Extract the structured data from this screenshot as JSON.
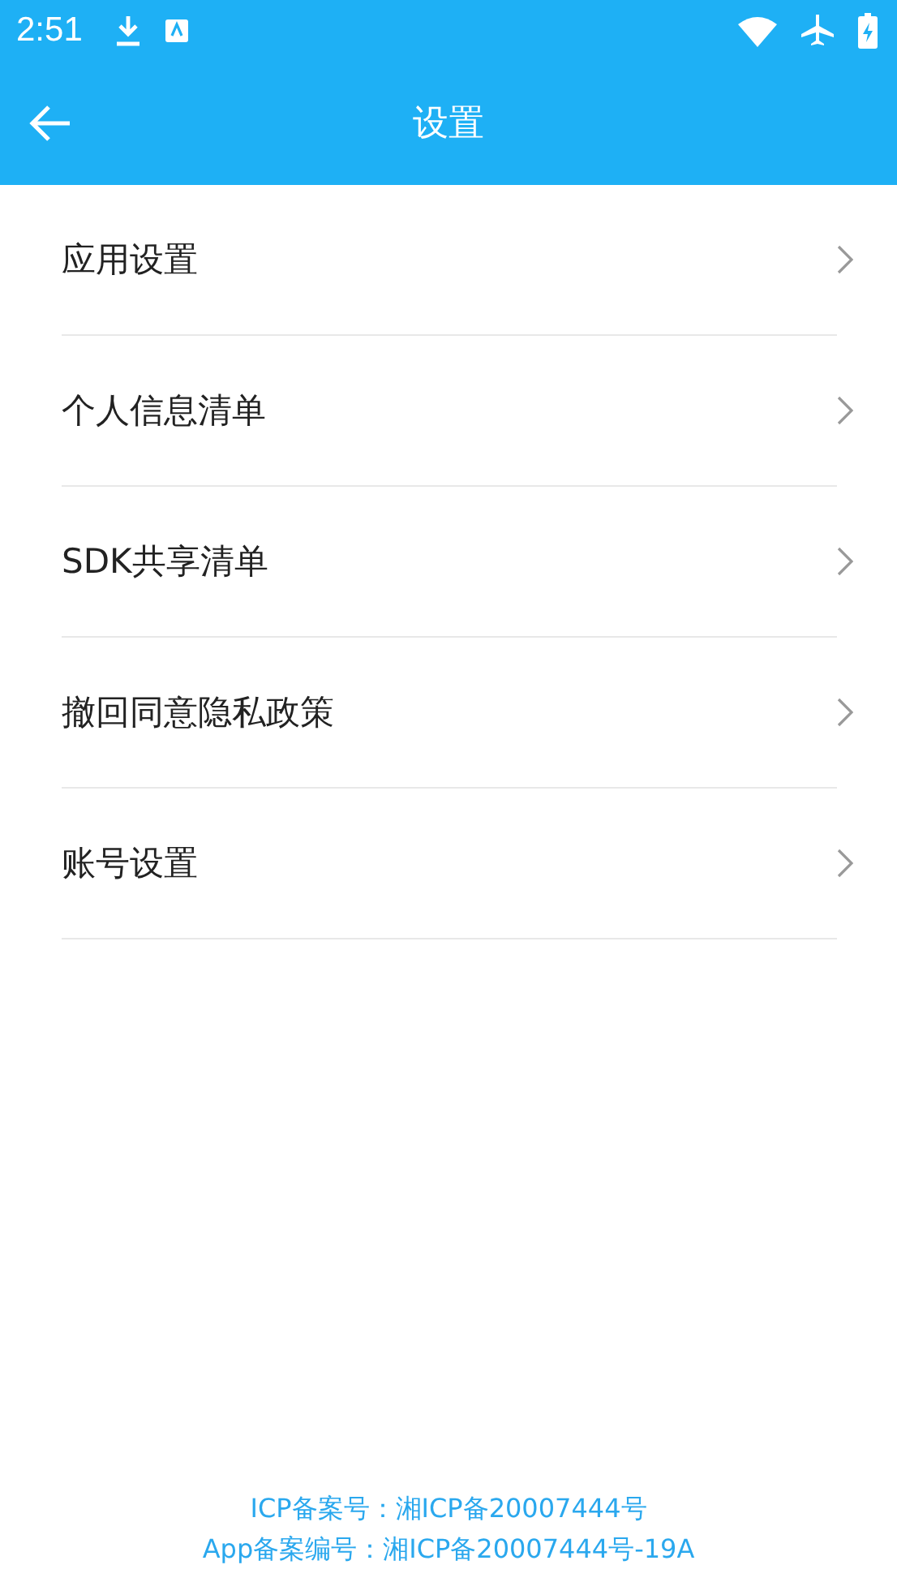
{
  "status_bar": {
    "time": "2:51"
  },
  "app_bar": {
    "title": "设置"
  },
  "menu_items": [
    {
      "label": "应用设置"
    },
    {
      "label": "个人信息清单"
    },
    {
      "label": "SDK共享清单"
    },
    {
      "label": "撤回同意隐私政策"
    },
    {
      "label": "账号设置"
    }
  ],
  "footer": [
    "ICP备案号：湘ICP备20007444号",
    "App备案编号：湘ICP备20007444号-19A"
  ]
}
